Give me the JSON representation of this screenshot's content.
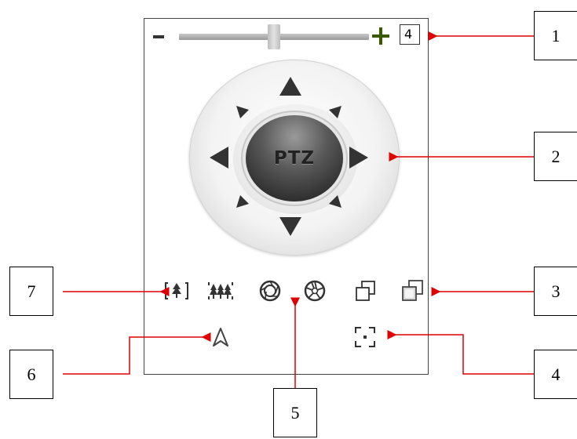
{
  "speed_slider": {
    "value": "4",
    "level": 0.5
  },
  "ptz": {
    "center_label": "PTZ"
  },
  "icons": [
    "zoom-wide-icon",
    "zoom-tele-icon",
    "iris-open-icon",
    "iris-close-icon",
    "focus-near-icon",
    "focus-far-icon",
    "auto-scan-icon",
    "three-d-position-icon"
  ],
  "colors": {
    "callout_line": "#e00000",
    "plus_icon": "#3a5a00"
  },
  "callouts": [
    {
      "label": "1"
    },
    {
      "label": "2"
    },
    {
      "label": "3"
    },
    {
      "label": "4"
    },
    {
      "label": "5"
    },
    {
      "label": "6"
    },
    {
      "label": "7"
    }
  ]
}
